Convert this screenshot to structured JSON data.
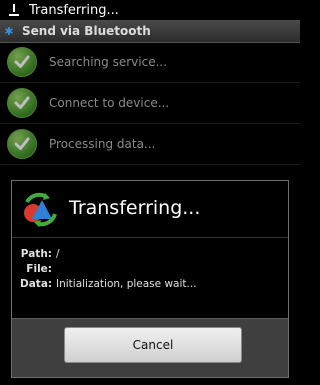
{
  "status": {
    "title": "Transferring..."
  },
  "titlebar": {
    "label": "Send via Bluetooth"
  },
  "steps": [
    {
      "label": "Searching service...",
      "icon": "checkmark-icon"
    },
    {
      "label": "Connect to device...",
      "icon": "checkmark-icon"
    },
    {
      "label": "Processing data...",
      "icon": "checkmark-icon"
    }
  ],
  "dialog": {
    "title": "Transferring...",
    "path_label": "Path:",
    "path_value": "/",
    "file_label": "File:",
    "file_value": "",
    "data_label": "Data:",
    "data_value": "Initialization, please wait...",
    "cancel_label": "Cancel"
  },
  "colors": {
    "check_green": "#3f8f26",
    "bluetooth_blue": "#3a8ed8"
  }
}
